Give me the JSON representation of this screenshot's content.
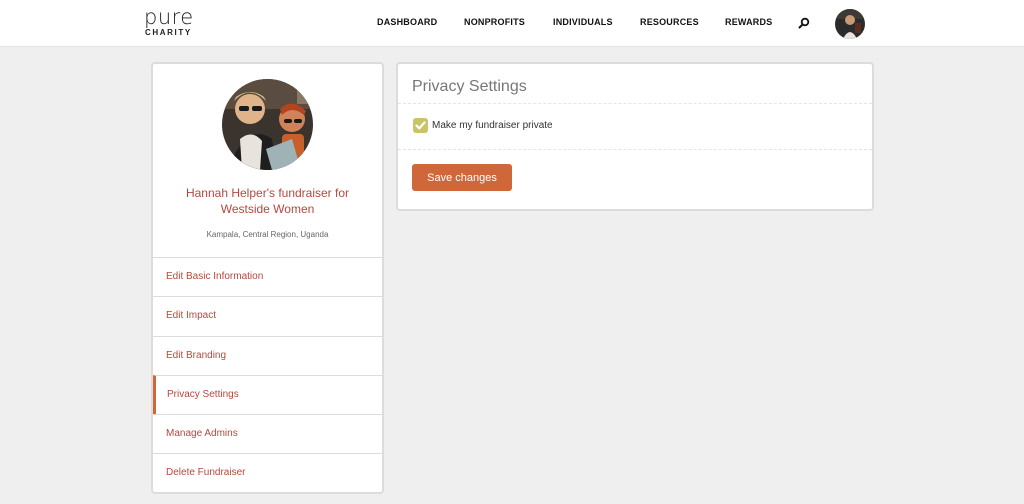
{
  "brand": {
    "name_top": "pure",
    "name_bottom": "CHARITY"
  },
  "nav": {
    "items": [
      {
        "label": "DASHBOARD"
      },
      {
        "label": "NONPROFITS"
      },
      {
        "label": "INDIVIDUALS"
      },
      {
        "label": "RESOURCES"
      },
      {
        "label": "REWARDS"
      }
    ],
    "search_icon": "search-icon",
    "avatar_icon": "user-avatar"
  },
  "sidebar": {
    "title": "Hannah Helper's fundraiser for Westside Women",
    "location": "Kampala, Central Region, Uganda",
    "items": [
      {
        "label": "Edit Basic Information"
      },
      {
        "label": "Edit Impact"
      },
      {
        "label": "Edit Branding"
      },
      {
        "label": "Privacy Settings",
        "active": true
      },
      {
        "label": "Manage Admins"
      },
      {
        "label": "Delete Fundraiser"
      }
    ]
  },
  "main": {
    "title": "Privacy Settings",
    "checkbox": {
      "label": "Make my fundraiser private",
      "checked": true
    },
    "save_label": "Save changes"
  },
  "colors": {
    "accent": "#d0673a",
    "link": "#b5483c",
    "checkbox": "#c9c46a",
    "background": "#efefef"
  }
}
